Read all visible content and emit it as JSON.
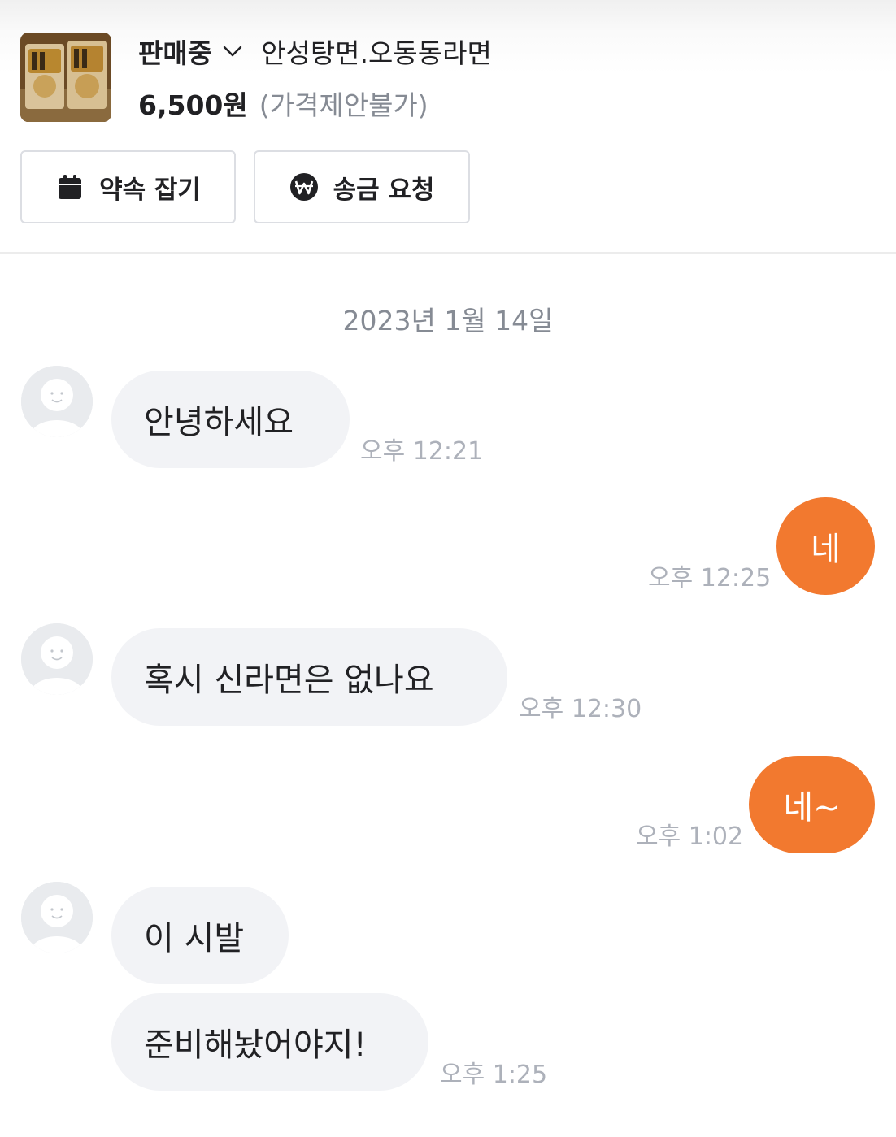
{
  "listing": {
    "thumbnail_icon": "product-photo-ramen",
    "status": "판매중",
    "title": "안성탕면.오동동라면",
    "price": "6,500원",
    "price_note": "(가격제안불가)"
  },
  "actions": {
    "appointment": {
      "label": "약속 잡기",
      "icon": "calendar-icon"
    },
    "transfer": {
      "label": "송금 요청",
      "icon": "won-icon"
    }
  },
  "chat": {
    "date": "2023년 1월 14일",
    "messages": [
      {
        "side": "in",
        "text": "안녕하세요",
        "time": "오후 12:21"
      },
      {
        "side": "out",
        "text": "네",
        "time": "오후 12:25"
      },
      {
        "side": "in",
        "text": "혹시 신라면은 없나요",
        "time": "오후 12:30"
      },
      {
        "side": "out",
        "text": "네~",
        "time": "오후 1:02"
      },
      {
        "side": "in",
        "text": "이 시발",
        "time": ""
      },
      {
        "side": "in",
        "text": "준비해놨어야지!",
        "time": "오후 1:25"
      }
    ]
  },
  "colors": {
    "accent": "#f2792f",
    "incoming_bubble": "#f2f3f6",
    "muted_text": "#868b94",
    "time_text": "#adb1ba"
  }
}
